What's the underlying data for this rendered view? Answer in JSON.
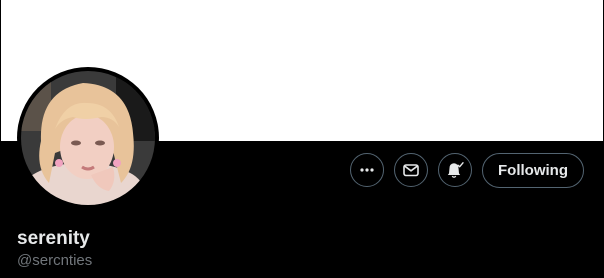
{
  "profile": {
    "display_name": "serenity",
    "username": "@sercnties",
    "avatar_icon": "profile-photo"
  },
  "actions": {
    "more_icon": "more-icon",
    "message_icon": "envelope-icon",
    "notify_icon": "bell-check-icon",
    "following_label": "Following"
  },
  "colors": {
    "banner": "#ffffff",
    "background": "#000000",
    "primary_text": "#e7e9ea",
    "secondary_text": "#71767b",
    "button_border": "#536471"
  }
}
